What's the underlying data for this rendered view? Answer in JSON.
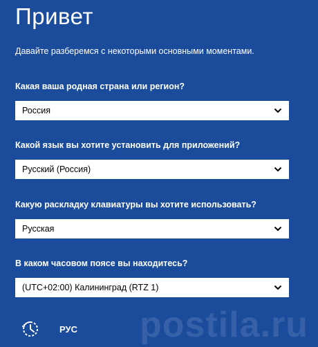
{
  "page": {
    "title": "Привет",
    "subtitle": "Давайте разберемся с некоторыми основными моментами."
  },
  "fields": [
    {
      "label": "Какая ваша родная страна или регион?",
      "value": "Россия"
    },
    {
      "label": "Какой язык вы хотите установить для приложений?",
      "value": "Русский (Россия)"
    },
    {
      "label": "Какую раскладку клавиатуры вы хотите использовать?",
      "value": "Русская"
    },
    {
      "label": "В каком часовом поясе вы находитесь?",
      "value": "(UTC+02:00) Калининград (RTZ 1)"
    }
  ],
  "bottom": {
    "accessibility_icon": "ease-of-access-icon",
    "language_label": "РУС"
  },
  "watermark": "postila.ru",
  "colors": {
    "background": "#1b4b9b",
    "select_bg": "#ffffff",
    "text": "#ffffff"
  }
}
